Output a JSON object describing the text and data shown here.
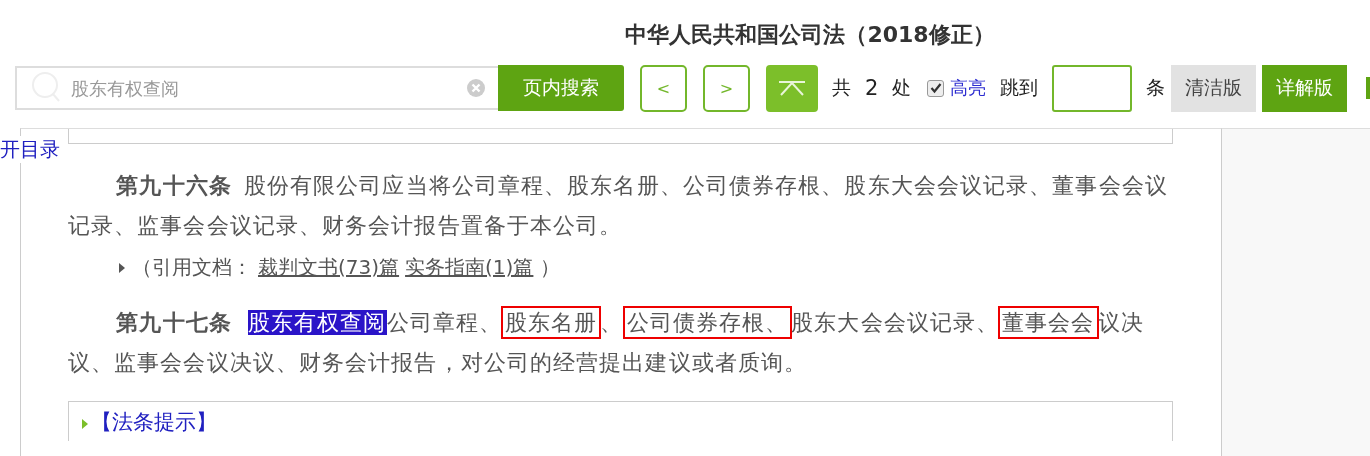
{
  "title": "中华人民共和国公司法（2018修正）",
  "search": {
    "placeholder": "股东有权查阅",
    "button": "页内搜索"
  },
  "nav": {
    "prev": "<",
    "next": ">"
  },
  "count": {
    "prefix": "共",
    "value": "2",
    "suffix": "处"
  },
  "highlight": {
    "checked": true,
    "label": "高亮"
  },
  "jump": {
    "label": "跳到",
    "unit": "条"
  },
  "versions": [
    {
      "label": "清洁版",
      "selected": false
    },
    {
      "label": "详解版",
      "selected": true
    }
  ],
  "toc_link": "开目录",
  "content": [
    {
      "kind": "article",
      "segments": [
        {
          "kind": "bold",
          "text": "第九十六条"
        },
        {
          "kind": "plain",
          "text": "股份有限公司应当将公司章程、股东名册、公司债券存根、股东大会会议记录、董事会会议记录、监事会会议记录、财务会计报告置备于本公司。"
        }
      ]
    },
    {
      "kind": "citation",
      "prefix": "（引用文档：",
      "links": [
        "裁判文书(73)篇",
        "实务指南(1)篇"
      ],
      "suffix": "）"
    },
    {
      "kind": "article",
      "segments": [
        {
          "kind": "bold",
          "text": "第九十七条"
        },
        {
          "kind": "highlight",
          "text": "股东有权查阅"
        },
        {
          "kind": "plain",
          "text": "公司章程、"
        },
        {
          "kind": "boxed",
          "text": "股东名册"
        },
        {
          "kind": "plain",
          "text": "、"
        },
        {
          "kind": "boxed",
          "text": "公司债券存根、"
        },
        {
          "kind": "plain",
          "text": "股东大会会议记录、"
        },
        {
          "kind": "boxed",
          "text": "董事会会"
        },
        {
          "kind": "plain",
          "text": "议决议、监事会会议决议、财务会计报告，对公司的经营提出建议或者质询。"
        }
      ]
    },
    {
      "kind": "section",
      "label": "【法条提示】",
      "expanded": false
    }
  ]
}
